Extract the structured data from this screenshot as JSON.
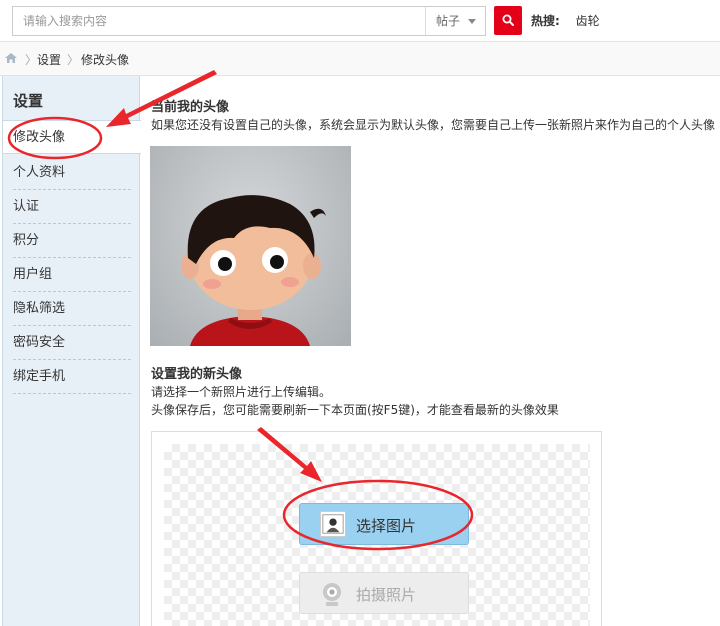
{
  "search": {
    "placeholder": "请输入搜索内容",
    "scope": "帖子",
    "hot_label": "热搜:",
    "hot_link": "齿轮"
  },
  "breadcrumb": {
    "items": [
      "设置",
      "修改头像"
    ]
  },
  "sidebar": {
    "title": "设置",
    "items": [
      {
        "label": "修改头像",
        "active": true
      },
      {
        "label": "个人资料"
      },
      {
        "label": "认证"
      },
      {
        "label": "积分"
      },
      {
        "label": "用户组"
      },
      {
        "label": "隐私筛选"
      },
      {
        "label": "密码安全"
      },
      {
        "label": "绑定手机"
      }
    ]
  },
  "main": {
    "current_title": "当前我的头像",
    "current_desc": "如果您还没有设置自己的头像，系统会显示为默认头像，您需要自己上传一张新照片来作为自己的个人头像",
    "new_title": "设置我的新头像",
    "new_desc1": "请选择一个新照片进行上传编辑。",
    "new_desc2": "头像保存后，您可能需要刷新一下本页面(按F5键)，才能查看最新的头像效果",
    "select_label": "选择图片",
    "capture_label": "拍摄照片"
  },
  "colors": {
    "accent_red": "#e5001a",
    "annotation_red": "#e8262b",
    "select_blue": "#9ad0f0"
  }
}
